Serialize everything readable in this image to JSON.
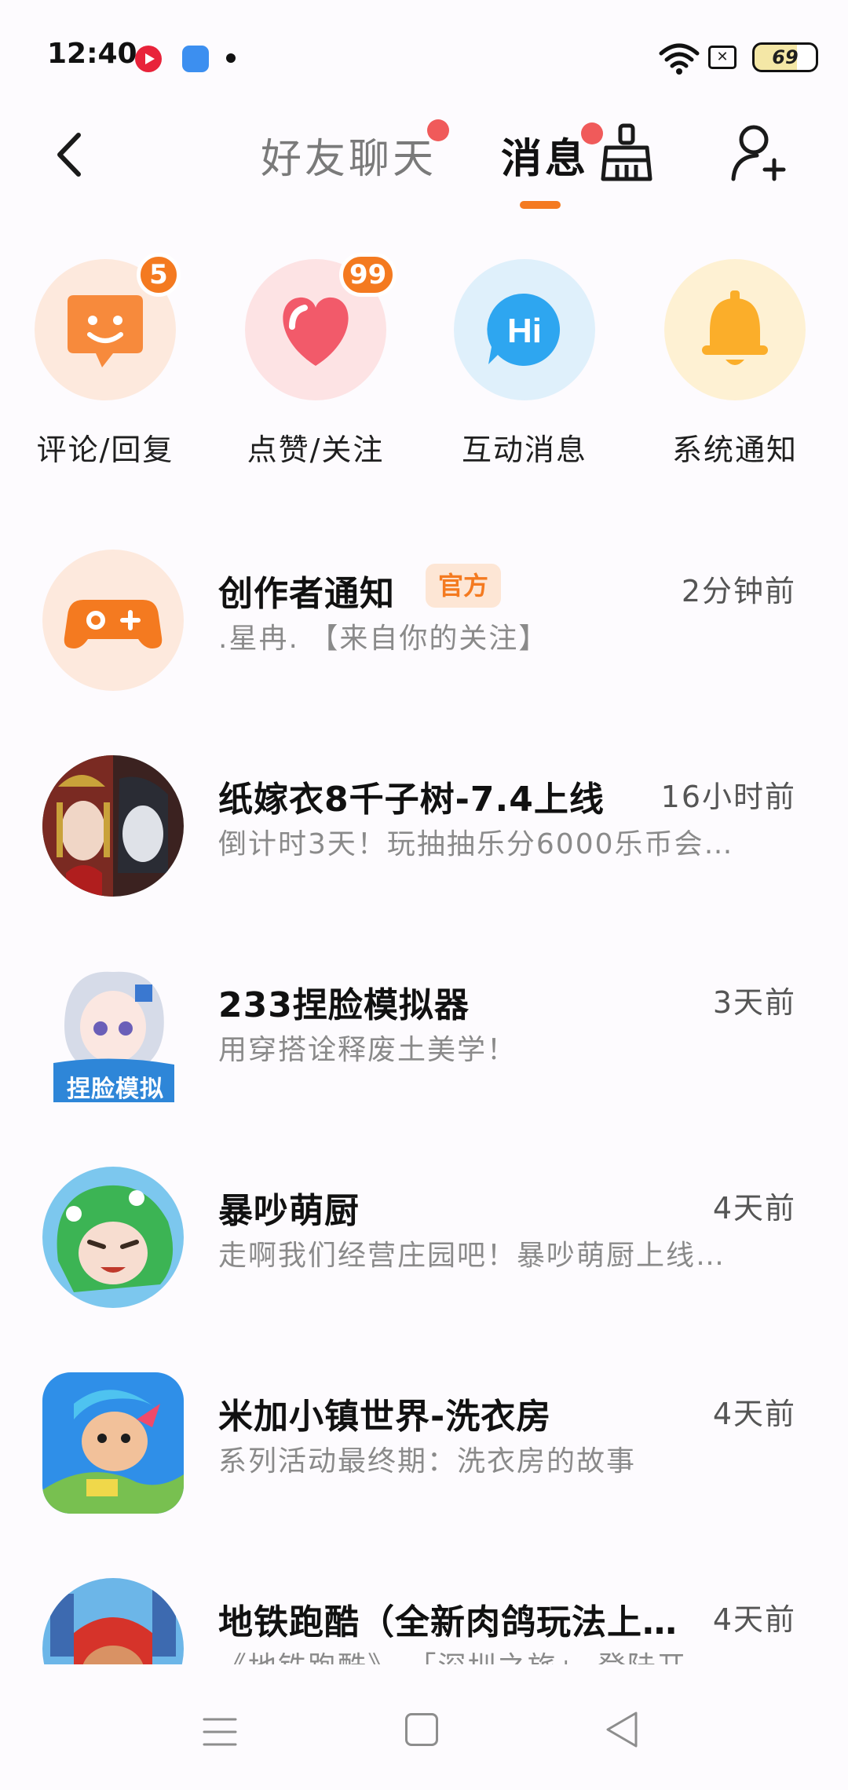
{
  "status_bar": {
    "time": "12:40",
    "sim_label": "✕",
    "battery": "69",
    "icons": [
      "video-app-icon",
      "browser-app-icon",
      "dot-icon",
      "wifi-icon",
      "sim-icon",
      "battery-icon"
    ]
  },
  "header": {
    "tabs": [
      {
        "label": "好友聊天",
        "has_dot": true,
        "active": false
      },
      {
        "label": "消息",
        "has_dot": true,
        "active": true
      }
    ],
    "accent_color": "#f47a20",
    "dot_color": "#f05a5a"
  },
  "quick_actions": [
    {
      "label": "评论/回复",
      "badge": "5",
      "icon": "comment-icon",
      "color": "#f78a3c"
    },
    {
      "label": "点赞/关注",
      "badge": "99",
      "icon": "heart-icon",
      "color": "#f25a6a"
    },
    {
      "label": "互动消息",
      "badge": "",
      "icon": "hi-bubble-icon",
      "color": "#2ea6f0"
    },
    {
      "label": "系统通知",
      "badge": "",
      "icon": "bell-icon",
      "color": "#fbae2a"
    }
  ],
  "messages": [
    {
      "title": "创作者通知",
      "badge": "官方",
      "time": "2分钟前",
      "preview": ".星冉. 【来自你的关注】",
      "avatar": "gamepad-icon"
    },
    {
      "title": "纸嫁衣8千子树-7.4上线",
      "badge": "",
      "time": "16小时前",
      "preview": "倒计时3天！玩抽抽乐分6000乐币会…",
      "avatar": "game-avatar-brides"
    },
    {
      "title": "233捏脸模拟器",
      "badge": "",
      "time": "3天前",
      "preview": "用穿搭诠释废土美学！",
      "avatar": "game-avatar-face-sim",
      "avatar_text": "捏脸模拟"
    },
    {
      "title": "暴吵萌厨",
      "badge": "",
      "time": "4天前",
      "preview": "走啊我们经营庄园吧！暴吵萌厨上线…",
      "avatar": "game-avatar-chef"
    },
    {
      "title": "米加小镇世界-洗衣房",
      "badge": "",
      "time": "4天前",
      "preview": "系列活动最终期：洗衣房的故事",
      "avatar": "game-avatar-toca"
    },
    {
      "title": "地铁跑酷（全新肉鸽玩法上…",
      "badge": "",
      "time": "4天前",
      "preview": "《地铁跑酷》 「深圳之旅」 登陆开…",
      "avatar": "game-avatar-subway"
    }
  ]
}
